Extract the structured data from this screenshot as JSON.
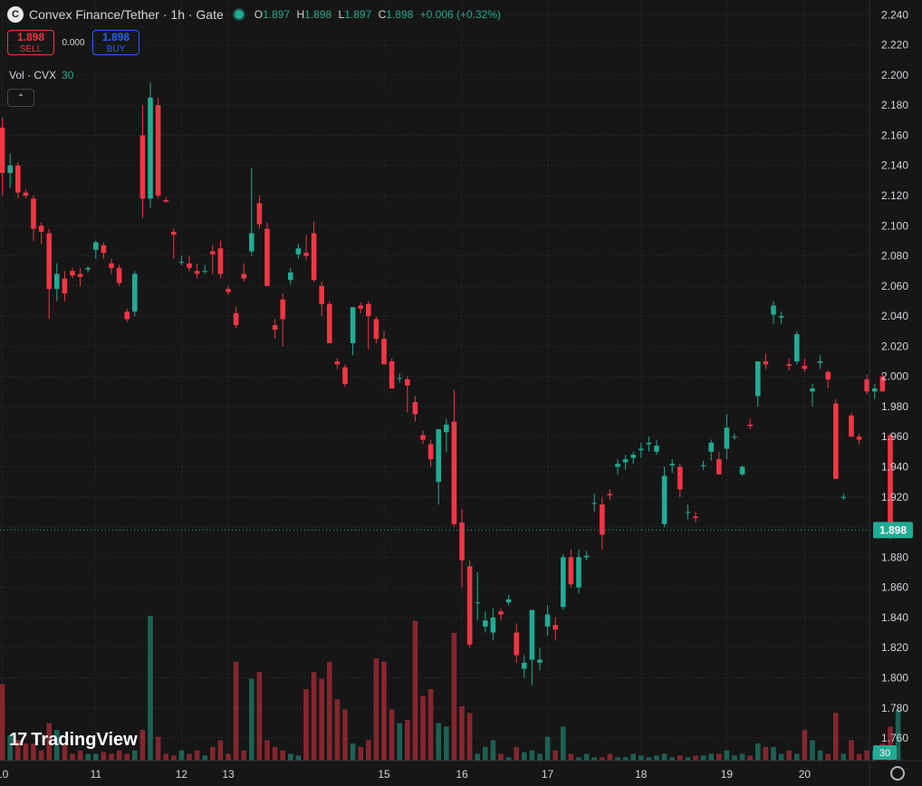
{
  "header": {
    "title": "Convex Finance/Tether · 1h · Gate",
    "open_label": "O",
    "open": "1.897",
    "high_label": "H",
    "high": "1.898",
    "low_label": "L",
    "low": "1.897",
    "close_label": "C",
    "close": "1.898",
    "change": "+0.006 (+0.32%)",
    "logo_letter": "C"
  },
  "trade": {
    "sell_price": "1.898",
    "sell_label": "SELL",
    "spread": "0.000",
    "buy_price": "1.898",
    "buy_label": "BUY"
  },
  "volume_legend": {
    "label": "Vol · CVX",
    "value": "30"
  },
  "branding": {
    "name": "TradingView",
    "mark": "17"
  },
  "colors": {
    "up": "#22ab94",
    "down": "#f23645",
    "background": "#161616",
    "grid": "#262626",
    "axis_text": "#d1d4dc"
  },
  "chart_data": {
    "type": "candlestick",
    "ylim": [
      1.745,
      2.245
    ],
    "y_ticks": [
      "2.240",
      "2.220",
      "2.200",
      "2.180",
      "2.160",
      "2.140",
      "2.120",
      "2.100",
      "2.080",
      "2.060",
      "2.040",
      "2.020",
      "2.000",
      "1.980",
      "1.960",
      "1.940",
      "1.920",
      "1.900",
      "1.880",
      "1.860",
      "1.840",
      "1.820",
      "1.800",
      "1.780",
      "1.760"
    ],
    "x_ticks": [
      "10",
      "11",
      "12",
      "13",
      "15",
      "16",
      "17",
      "18",
      "19",
      "20"
    ],
    "x_tick_index": [
      1,
      13,
      24,
      30,
      50,
      60,
      71,
      83,
      94,
      104
    ],
    "last_price_label": "1.898",
    "last_volume_label": "30",
    "candles": [
      [
        2.175,
        2.185,
        2.12,
        2.165,
        20
      ],
      [
        2.165,
        2.172,
        2.12,
        2.135,
        45
      ],
      [
        2.135,
        2.148,
        2.125,
        2.14,
        15
      ],
      [
        2.14,
        2.142,
        2.118,
        2.122,
        12
      ],
      [
        2.122,
        2.124,
        2.118,
        2.12,
        10
      ],
      [
        2.118,
        2.12,
        2.09,
        2.098,
        10
      ],
      [
        2.1,
        2.102,
        2.088,
        2.096,
        6
      ],
      [
        2.095,
        2.098,
        2.038,
        2.058,
        22
      ],
      [
        2.058,
        2.075,
        2.05,
        2.068,
        18
      ],
      [
        2.065,
        2.07,
        2.05,
        2.055,
        10
      ],
      [
        2.07,
        2.072,
        2.065,
        2.067,
        4
      ],
      [
        2.068,
        2.072,
        2.06,
        2.066,
        6
      ],
      [
        2.071,
        2.073,
        2.069,
        2.072,
        4
      ],
      [
        2.084,
        2.09,
        2.078,
        2.089,
        4
      ],
      [
        2.087,
        2.089,
        2.078,
        2.082,
        5
      ],
      [
        2.075,
        2.078,
        2.068,
        2.072,
        4
      ],
      [
        2.072,
        2.074,
        2.06,
        2.062,
        6
      ],
      [
        2.043,
        2.045,
        2.036,
        2.038,
        4
      ],
      [
        2.043,
        2.07,
        2.04,
        2.068,
        6
      ],
      [
        2.16,
        2.18,
        2.105,
        2.118,
        18
      ],
      [
        2.118,
        2.195,
        2.112,
        2.185,
        85
      ],
      [
        2.18,
        2.185,
        2.118,
        2.12,
        14
      ],
      [
        2.117,
        2.119,
        2.115,
        2.116,
        4
      ],
      [
        2.096,
        2.098,
        2.078,
        2.094,
        3
      ],
      [
        2.076,
        2.08,
        2.074,
        2.076,
        6
      ],
      [
        2.075,
        2.08,
        2.07,
        2.072,
        4
      ],
      [
        2.07,
        2.075,
        2.065,
        2.068,
        6
      ],
      [
        2.07,
        2.074,
        2.068,
        2.07,
        3
      ],
      [
        2.083,
        2.087,
        2.068,
        2.081,
        8
      ],
      [
        2.085,
        2.09,
        2.065,
        2.068,
        12
      ],
      [
        2.058,
        2.06,
        2.054,
        2.056,
        4
      ],
      [
        2.042,
        2.046,
        2.032,
        2.034,
        58
      ],
      [
        2.068,
        2.075,
        2.063,
        2.065,
        6
      ],
      [
        2.083,
        2.138,
        2.08,
        2.095,
        48
      ],
      [
        2.115,
        2.12,
        2.098,
        2.101,
        52
      ],
      [
        2.098,
        2.102,
        2.06,
        2.06,
        12
      ],
      [
        2.034,
        2.038,
        2.025,
        2.031,
        8
      ],
      [
        2.051,
        2.055,
        2.02,
        2.038,
        6
      ],
      [
        2.064,
        2.072,
        2.061,
        2.069,
        4
      ],
      [
        2.081,
        2.088,
        2.078,
        2.085,
        3
      ],
      [
        2.082,
        2.094,
        2.077,
        2.08,
        42
      ],
      [
        2.095,
        2.103,
        2.063,
        2.064,
        52
      ],
      [
        2.06,
        2.063,
        2.04,
        2.048,
        48
      ],
      [
        2.048,
        2.05,
        2.03,
        2.022,
        58
      ],
      [
        2.01,
        2.012,
        2.005,
        2.008,
        36
      ],
      [
        2.006,
        2.008,
        1.993,
        1.995,
        30
      ],
      [
        2.022,
        2.046,
        2.014,
        2.046,
        10
      ],
      [
        2.047,
        2.049,
        2.042,
        2.045,
        8
      ],
      [
        2.048,
        2.05,
        2.018,
        2.04,
        12
      ],
      [
        2.038,
        2.04,
        2.022,
        2.025,
        60
      ],
      [
        2.025,
        2.03,
        2.01,
        2.008,
        58
      ],
      [
        2.01,
        2.012,
        1.992,
        1.992,
        30
      ],
      [
        1.999,
        2.002,
        1.996,
        1.999,
        22
      ],
      [
        1.998,
        2.0,
        1.976,
        1.994,
        24
      ],
      [
        1.983,
        1.987,
        1.97,
        1.975,
        82
      ],
      [
        1.961,
        1.964,
        1.955,
        1.958,
        38
      ],
      [
        1.955,
        1.958,
        1.94,
        1.945,
        42
      ],
      [
        1.93,
        1.96,
        1.915,
        1.965,
        22
      ],
      [
        1.963,
        1.972,
        1.95,
        1.968,
        20
      ],
      [
        1.97,
        1.991,
        1.9,
        1.902,
        75
      ],
      [
        1.903,
        1.912,
        1.86,
        1.878,
        32
      ],
      [
        1.874,
        1.878,
        1.82,
        1.822,
        28
      ],
      [
        1.85,
        1.87,
        1.838,
        1.85,
        4
      ],
      [
        1.834,
        1.844,
        1.83,
        1.838,
        8
      ],
      [
        1.83,
        1.846,
        1.825,
        1.84,
        12
      ],
      [
        1.844,
        1.846,
        1.838,
        1.842,
        4
      ],
      [
        1.85,
        1.855,
        1.848,
        1.852,
        2
      ],
      [
        1.83,
        1.836,
        1.81,
        1.815,
        8
      ],
      [
        1.806,
        1.815,
        1.8,
        1.81,
        5
      ],
      [
        1.812,
        1.845,
        1.795,
        1.845,
        6
      ],
      [
        1.81,
        1.82,
        1.805,
        1.812,
        4
      ],
      [
        1.834,
        1.848,
        1.828,
        1.842,
        14
      ],
      [
        1.835,
        1.84,
        1.825,
        1.832,
        6
      ],
      [
        1.847,
        1.882,
        1.845,
        1.88,
        20
      ],
      [
        1.88,
        1.885,
        1.86,
        1.862,
        4
      ],
      [
        1.86,
        1.885,
        1.856,
        1.88,
        2
      ],
      [
        1.88,
        1.884,
        1.878,
        1.881,
        4
      ],
      [
        1.916,
        1.922,
        1.91,
        1.916,
        2
      ],
      [
        1.915,
        1.92,
        1.885,
        1.895,
        2
      ],
      [
        1.922,
        1.925,
        1.918,
        1.921,
        4
      ],
      [
        1.94,
        1.945,
        1.935,
        1.942,
        2
      ],
      [
        1.943,
        1.948,
        1.938,
        1.945,
        2
      ],
      [
        1.946,
        1.95,
        1.942,
        1.948,
        4
      ],
      [
        1.951,
        1.956,
        1.946,
        1.952,
        3
      ],
      [
        1.955,
        1.96,
        1.95,
        1.956,
        2
      ],
      [
        1.95,
        1.958,
        1.948,
        1.954,
        3
      ],
      [
        1.902,
        1.94,
        1.9,
        1.934,
        4
      ],
      [
        1.941,
        1.945,
        1.936,
        1.942,
        2
      ],
      [
        1.94,
        1.942,
        1.92,
        1.925,
        3
      ],
      [
        1.91,
        1.915,
        1.905,
        1.91,
        2
      ],
      [
        1.907,
        1.91,
        1.903,
        1.906,
        3
      ],
      [
        1.941,
        1.944,
        1.938,
        1.941,
        3
      ],
      [
        1.95,
        1.958,
        1.944,
        1.956,
        4
      ],
      [
        1.945,
        1.95,
        1.935,
        1.935,
        4
      ],
      [
        1.952,
        1.975,
        1.945,
        1.966,
        6
      ],
      [
        1.96,
        1.962,
        1.958,
        1.96,
        3
      ],
      [
        1.935,
        1.941,
        1.934,
        1.94,
        4
      ],
      [
        1.968,
        1.972,
        1.965,
        1.967,
        3
      ],
      [
        1.987,
        1.996,
        1.98,
        2.01,
        10
      ],
      [
        2.01,
        2.015,
        2.005,
        2.008,
        8
      ],
      [
        2.041,
        2.05,
        2.035,
        2.047,
        8
      ],
      [
        2.039,
        2.043,
        2.035,
        2.04,
        4
      ],
      [
        2.008,
        2.012,
        2.004,
        2.007,
        6
      ],
      [
        2.01,
        2.03,
        2.008,
        2.028,
        4
      ],
      [
        2.007,
        2.012,
        2.003,
        2.005,
        18
      ],
      [
        1.99,
        1.995,
        1.98,
        1.992,
        12
      ],
      [
        2.009,
        2.014,
        2.005,
        2.01,
        6
      ],
      [
        2.003,
        2.004,
        1.992,
        1.998,
        4
      ],
      [
        1.982,
        1.985,
        1.96,
        1.932,
        28
      ],
      [
        1.92,
        1.922,
        1.918,
        1.92,
        4
      ],
      [
        1.974,
        1.976,
        1.96,
        1.96,
        12
      ],
      [
        1.96,
        1.962,
        1.955,
        1.958,
        4
      ],
      [
        1.998,
        2.001,
        1.988,
        1.99,
        6
      ],
      [
        1.99,
        1.995,
        1.985,
        1.992,
        6
      ],
      [
        2.0,
        2.002,
        1.99,
        1.99,
        10
      ],
      [
        1.961,
        1.962,
        1.892,
        1.896,
        20
      ],
      [
        1.897,
        1.898,
        1.897,
        1.898,
        30
      ]
    ]
  }
}
